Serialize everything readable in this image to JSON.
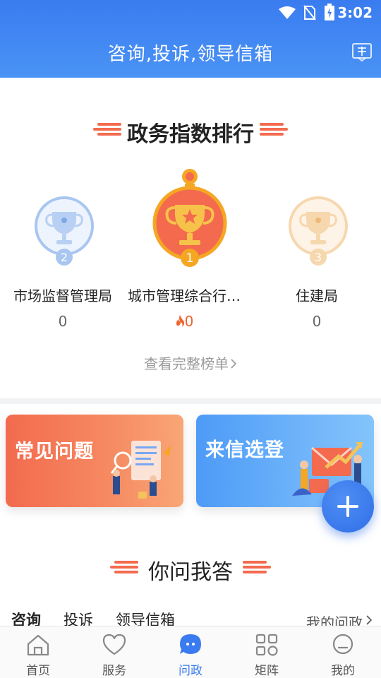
{
  "status": {
    "time": "3:02"
  },
  "header": {
    "title": "咨询,投诉,领导信箱",
    "action_icon": "book-icon"
  },
  "ranking": {
    "title": "政务指数排行",
    "items": [
      {
        "place": "2",
        "name": "市场监督管理局",
        "value": "0"
      },
      {
        "place": "1",
        "name": "城市管理综合行…",
        "value": "0",
        "hot": true
      },
      {
        "place": "3",
        "name": "住建局",
        "value": "0"
      }
    ],
    "view_all": "查看完整榜单"
  },
  "cards": {
    "faq": {
      "label": "常见问题"
    },
    "letters": {
      "label": "来信选登"
    }
  },
  "qa": {
    "title": "你问我答",
    "tabs": [
      "咨询",
      "投诉",
      "领导信箱"
    ],
    "my_link": "我的问政"
  },
  "nav": {
    "items": [
      {
        "label": "首页",
        "icon": "home-icon"
      },
      {
        "label": "服务",
        "icon": "heart-icon"
      },
      {
        "label": "问政",
        "icon": "chat-icon",
        "active": true
      },
      {
        "label": "矩阵",
        "icon": "grid-icon"
      },
      {
        "label": "我的",
        "icon": "profile-icon"
      }
    ]
  },
  "colors": {
    "primary": "#3a7cf0",
    "accent": "#f36a4e",
    "gold": "#f5a623"
  }
}
